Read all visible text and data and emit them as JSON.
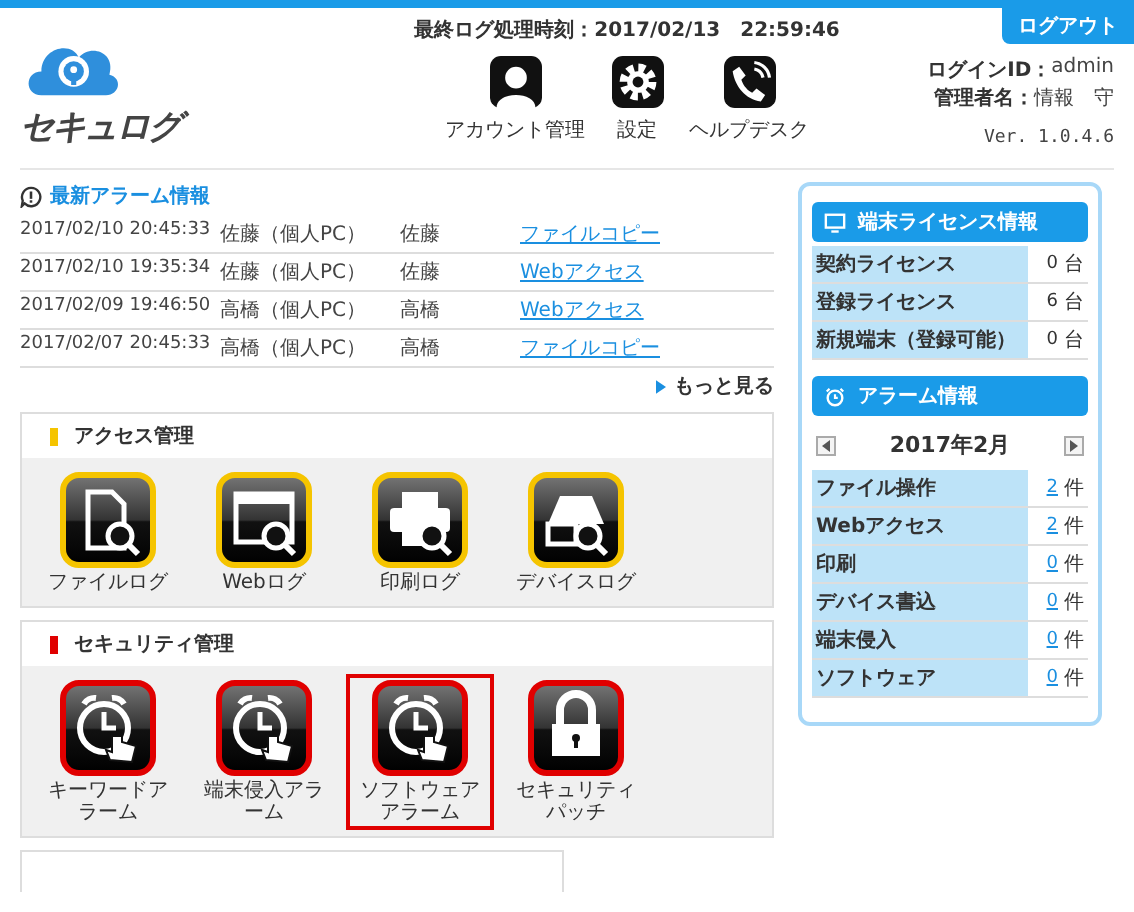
{
  "header": {
    "logo_text": "セキュログ",
    "last_processed": "最終ログ処理時刻：2017/02/13　22:59:46",
    "logout": "ログアウト",
    "nav": [
      {
        "kind": "account",
        "label": "アカウント管理"
      },
      {
        "kind": "settings",
        "label": "設定"
      },
      {
        "kind": "helpdesk",
        "label": "ヘルプデスク"
      }
    ],
    "login_id_label": "ログインID：",
    "login_id": "admin",
    "admin_name_label": "管理者名：",
    "admin_name": "情報　守",
    "version": "Ver. 1.0.4.6"
  },
  "latest_alarms": {
    "title": "最新アラーム情報",
    "more": "もっと見る",
    "rows": [
      {
        "time": "2017/02/10 20:45:33",
        "terminal": "佐藤（個人PC）",
        "user": "佐藤",
        "event": "ファイルコピー"
      },
      {
        "time": "2017/02/10 19:35:34",
        "terminal": "佐藤（個人PC）",
        "user": "佐藤",
        "event": "Webアクセス"
      },
      {
        "time": "2017/02/09 19:46:50",
        "terminal": "高橋（個人PC）",
        "user": "高橋",
        "event": "Webアクセス"
      },
      {
        "time": "2017/02/07 20:45:33",
        "terminal": "高橋（個人PC）",
        "user": "高橋",
        "event": "ファイルコピー"
      }
    ]
  },
  "sections": [
    {
      "title": "アクセス管理",
      "color": "#f5c400",
      "tiles": [
        {
          "kind": "file",
          "label": "ファイルログ",
          "selected": false
        },
        {
          "kind": "web",
          "label": "Webログ",
          "selected": false
        },
        {
          "kind": "print",
          "label": "印刷ログ",
          "selected": false
        },
        {
          "kind": "device",
          "label": "デバイスログ",
          "selected": false
        }
      ]
    },
    {
      "title": "セキュリティ管理",
      "color": "#e00000",
      "tiles": [
        {
          "kind": "alarm",
          "label": "キーワードアラーム",
          "selected": false
        },
        {
          "kind": "alarm",
          "label": "端末侵入アラーム",
          "selected": false
        },
        {
          "kind": "alarm",
          "label": "ソフトウェアアラーム",
          "selected": true
        },
        {
          "kind": "lock",
          "label": "セキュリティパッチ",
          "selected": false
        }
      ]
    }
  ],
  "license": {
    "title": "端末ライセンス情報",
    "rows": [
      {
        "label": "契約ライセンス",
        "value": "0",
        "unit": "台"
      },
      {
        "label": "登録ライセンス",
        "value": "6",
        "unit": "台"
      },
      {
        "label": "新規端末（登録可能）",
        "value": "0",
        "unit": "台"
      }
    ]
  },
  "alarm_info": {
    "title": "アラーム情報",
    "month": "2017年2月",
    "rows": [
      {
        "label": "ファイル操作",
        "count": "2",
        "unit": "件"
      },
      {
        "label": "Webアクセス",
        "count": "2",
        "unit": "件"
      },
      {
        "label": "印刷",
        "count": "0",
        "unit": "件"
      },
      {
        "label": "デバイス書込",
        "count": "0",
        "unit": "件"
      },
      {
        "label": "端末侵入",
        "count": "0",
        "unit": "件"
      },
      {
        "label": "ソフトウェア",
        "count": "0",
        "unit": "件"
      }
    ]
  }
}
